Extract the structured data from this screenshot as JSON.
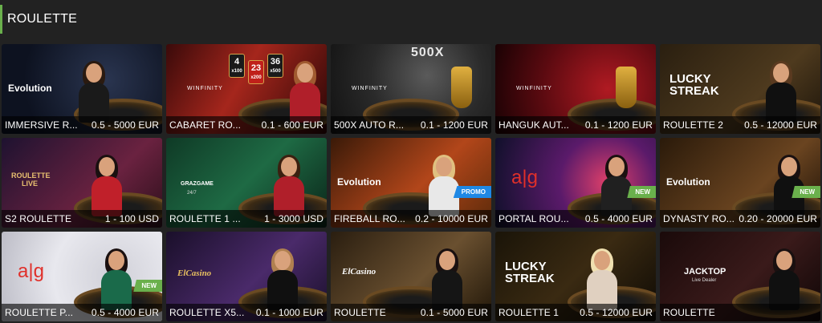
{
  "header": {
    "title": "ROULETTE"
  },
  "games": [
    {
      "name": "IMMERSIVE R...",
      "limits": "0.5 - 5000 EUR",
      "provider": "Evolution",
      "theme": "dark-blue",
      "badge": ""
    },
    {
      "name": "CABARET RO...",
      "limits": "0.1 - 600 EUR",
      "provider": "WINFINITY",
      "theme": "red",
      "badge": "",
      "numbers": [
        "4",
        "23",
        "36"
      ],
      "multipliers": [
        "x100",
        "x200",
        "x500"
      ]
    },
    {
      "name": "500X AUTO R...",
      "limits": "0.1 - 1200 EUR",
      "provider": "WINFINITY",
      "theme": "gray",
      "badge": "",
      "headline": "500X"
    },
    {
      "name": "HANGUK AUT...",
      "limits": "0.1 - 1200 EUR",
      "provider": "WINFINITY",
      "theme": "crimson",
      "badge": ""
    },
    {
      "name": "ROULETTE 2",
      "limits": "0.5 - 12000 EUR",
      "provider": "LUCKY STREAK",
      "theme": "brown",
      "badge": ""
    },
    {
      "name": "S2 ROULETTE",
      "limits": "1 - 100 USD",
      "provider": "ROULETTE LIVE",
      "theme": "violet",
      "badge": ""
    },
    {
      "name": "ROULETTE 1 ...",
      "limits": "1 - 3000 USD",
      "provider": "GRAZGAME",
      "provider_sub": "24/7",
      "theme": "green",
      "badge": ""
    },
    {
      "name": "FIREBALL RO...",
      "limits": "0.2 - 10000 EUR",
      "provider": "Evolution",
      "theme": "orange",
      "badge": "PROMO"
    },
    {
      "name": "PORTAL ROU...",
      "limits": "0.5 - 4000 EUR",
      "provider": "a|g",
      "theme": "neon",
      "badge": "NEW"
    },
    {
      "name": "DYNASTY RO...",
      "limits": "0.20 - 20000 EUR",
      "provider": "Evolution",
      "theme": "amber",
      "badge": "NEW"
    },
    {
      "name": "ROULETTE P...",
      "limits": "0.5 - 4000 EUR",
      "provider": "a|g",
      "theme": "white",
      "badge": "NEW"
    },
    {
      "name": "ROULETTE X5...",
      "limits": "0.1 - 1000 EUR",
      "provider": "ElCasino",
      "theme": "purple",
      "badge": ""
    },
    {
      "name": "ROULETTE",
      "limits": "0.1 - 5000 EUR",
      "provider": "ElCasino",
      "theme": "gold",
      "badge": ""
    },
    {
      "name": "ROULETTE 1",
      "limits": "0.5 - 12000 EUR",
      "provider": "LUCKY STREAK",
      "theme": "night",
      "badge": ""
    },
    {
      "name": "ROULETTE",
      "limits": "",
      "provider": "JACKTOP",
      "provider_sub": "Live Dealer",
      "theme": "darkred",
      "badge": ""
    }
  ],
  "colors": {
    "page_bg": "#222222",
    "accent": "#6ab04c",
    "badge_new": "#6ab04c",
    "badge_promo": "#1e88e5"
  }
}
